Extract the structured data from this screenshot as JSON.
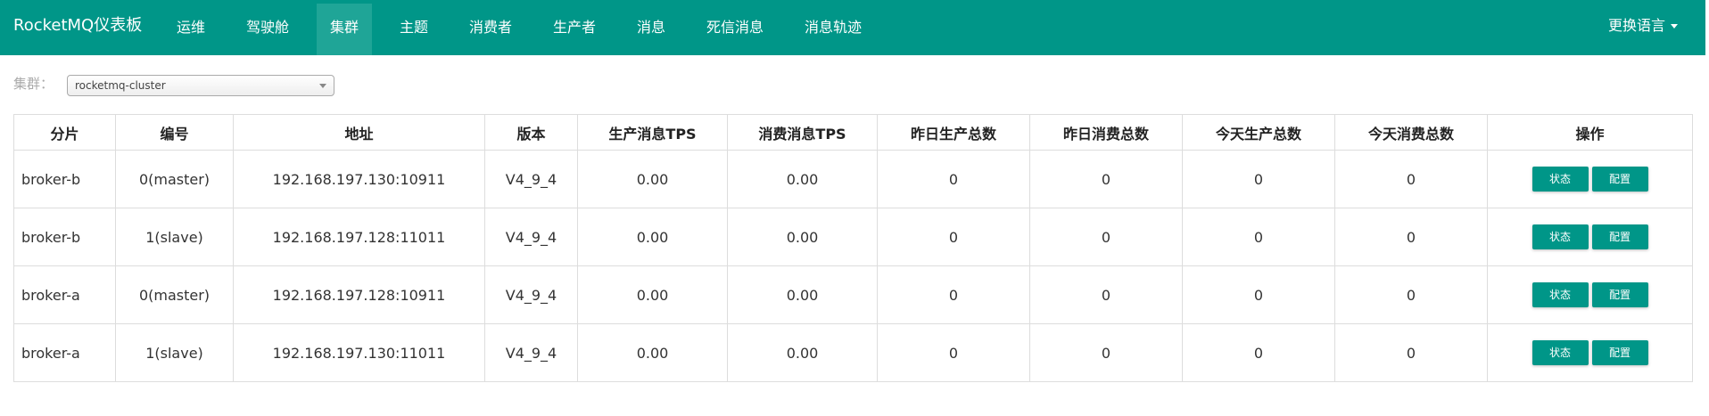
{
  "navbar": {
    "brand": "RocketMQ仪表板",
    "items": [
      {
        "label": "运维"
      },
      {
        "label": "驾驶舱"
      },
      {
        "label": "集群"
      },
      {
        "label": "主题"
      },
      {
        "label": "消费者"
      },
      {
        "label": "生产者"
      },
      {
        "label": "消息"
      },
      {
        "label": "死信消息"
      },
      {
        "label": "消息轨迹"
      }
    ],
    "language": "更换语言",
    "accent_color": "#009688",
    "active_color": "#1fa597"
  },
  "filter": {
    "cluster_label": "集群：",
    "cluster_value": "rocketmq-cluster"
  },
  "table": {
    "headers": [
      "分片",
      "编号",
      "地址",
      "版本",
      "生产消息TPS",
      "消费消息TPS",
      "昨日生产总数",
      "昨日消费总数",
      "今天生产总数",
      "今天消费总数",
      "操作"
    ],
    "rows": [
      {
        "shard": "broker-b",
        "no": "0(master)",
        "address": "192.168.197.130:10911",
        "version": "V4_9_4",
        "produce_tps": "0.00",
        "consume_tps": "0.00",
        "yesterday_produce": "0",
        "yesterday_consume": "0",
        "today_produce": "0",
        "today_consume": "0"
      },
      {
        "shard": "broker-b",
        "no": "1(slave)",
        "address": "192.168.197.128:11011",
        "version": "V4_9_4",
        "produce_tps": "0.00",
        "consume_tps": "0.00",
        "yesterday_produce": "0",
        "yesterday_consume": "0",
        "today_produce": "0",
        "today_consume": "0"
      },
      {
        "shard": "broker-a",
        "no": "0(master)",
        "address": "192.168.197.128:10911",
        "version": "V4_9_4",
        "produce_tps": "0.00",
        "consume_tps": "0.00",
        "yesterday_produce": "0",
        "yesterday_consume": "0",
        "today_produce": "0",
        "today_consume": "0"
      },
      {
        "shard": "broker-a",
        "no": "1(slave)",
        "address": "192.168.197.130:11011",
        "version": "V4_9_4",
        "produce_tps": "0.00",
        "consume_tps": "0.00",
        "yesterday_produce": "0",
        "yesterday_consume": "0",
        "today_produce": "0",
        "today_consume": "0"
      }
    ],
    "actions": {
      "status": "状态",
      "config": "配置"
    }
  }
}
